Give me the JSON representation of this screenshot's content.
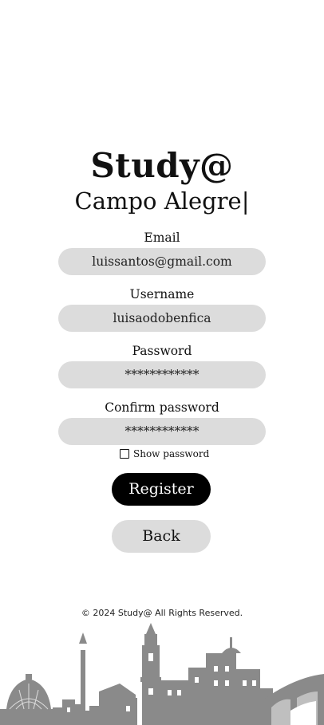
{
  "header": {
    "title": "Study@",
    "subtitle": "Campo Alegre|"
  },
  "form": {
    "email": {
      "label": "Email",
      "value": "luissantos@gmail.com"
    },
    "username": {
      "label": "Username",
      "value": "luisaodobenfica"
    },
    "password": {
      "label": "Password",
      "value": "************"
    },
    "confirm_password": {
      "label": "Confirm password",
      "value": "************"
    },
    "show_password": {
      "label": "Show password",
      "checked": false
    }
  },
  "buttons": {
    "register": "Register",
    "back": "Back"
  },
  "footer": {
    "copyright": "© 2024 Study@ All Rights Reserved."
  },
  "colors": {
    "field_bg": "#dcdcdc",
    "primary_button": "#000000",
    "skyline": "#8a8a8a"
  }
}
